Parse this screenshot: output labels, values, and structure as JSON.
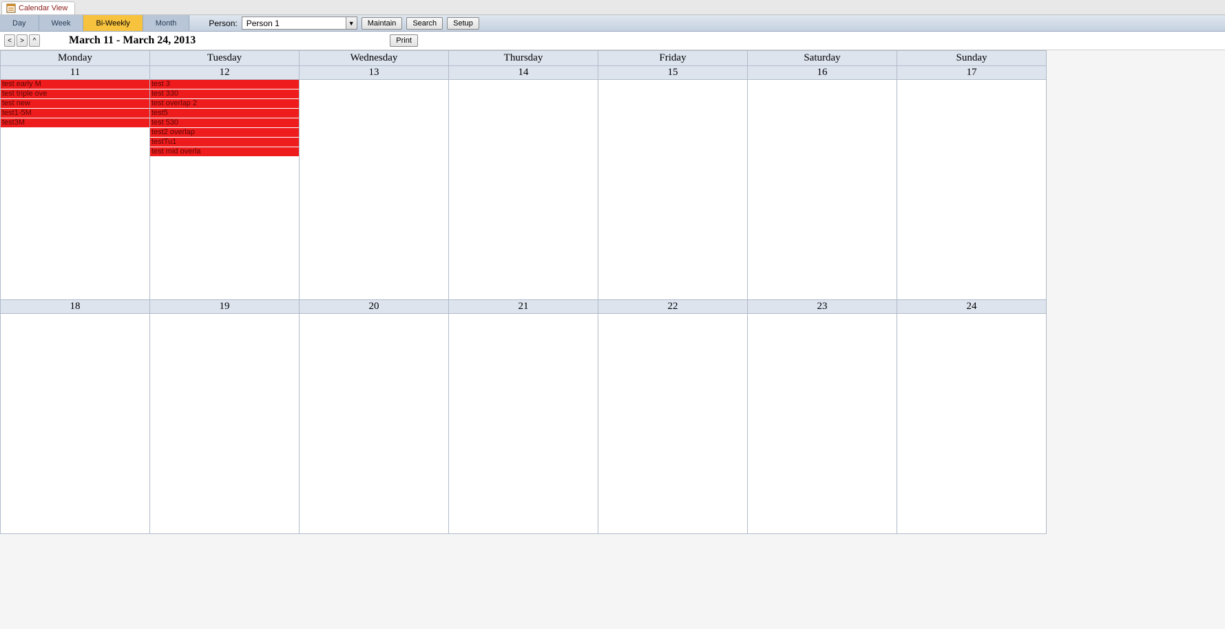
{
  "tab": {
    "title": "Calendar View"
  },
  "viewTabs": {
    "items": [
      {
        "label": "Day",
        "active": false
      },
      {
        "label": "Week",
        "active": false
      },
      {
        "label": "Bi-Weekly",
        "active": true
      },
      {
        "label": "Month",
        "active": false
      }
    ]
  },
  "person": {
    "label": "Person:",
    "value": "Person 1"
  },
  "buttons": {
    "maintain": "Maintain",
    "search": "Search",
    "setup": "Setup",
    "print": "Print"
  },
  "nav": {
    "prev": "<",
    "next": ">",
    "up": "^",
    "dateRange": "March 11 - March 24, 2013"
  },
  "dayHeaders": [
    "Monday",
    "Tuesday",
    "Wednesday",
    "Thursday",
    "Friday",
    "Saturday",
    "Sunday"
  ],
  "week1": {
    "nums": [
      "11",
      "12",
      "13",
      "14",
      "15",
      "16",
      "17"
    ],
    "events": [
      [
        "test early M",
        "test triple ove",
        "test new",
        "test1-5M",
        "test3M"
      ],
      [
        "test 3",
        "test 330",
        "test overlap 2",
        "test5",
        "test 530",
        "test2 overlap",
        "testTu1",
        "test mid overla"
      ],
      [],
      [],
      [],
      [],
      []
    ]
  },
  "week2": {
    "nums": [
      "18",
      "19",
      "20",
      "21",
      "22",
      "23",
      "24"
    ],
    "events": [
      [],
      [],
      [],
      [],
      [],
      [],
      []
    ]
  }
}
